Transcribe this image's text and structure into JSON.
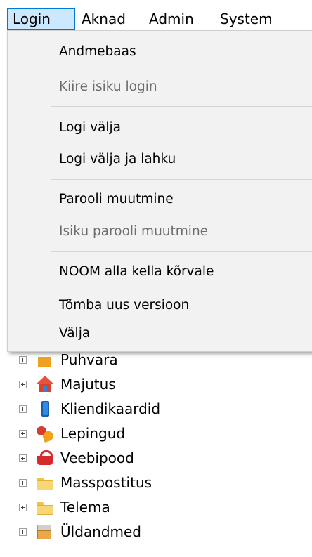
{
  "menubar": {
    "items": [
      "Login",
      "Aknad",
      "Admin",
      "System"
    ]
  },
  "login_menu": {
    "items": [
      {
        "label": "Andmebaas"
      },
      {
        "label": "Kiire isiku login"
      },
      {
        "label": "Logi välja"
      },
      {
        "label": "Logi välja ja lahku"
      },
      {
        "label": "Parooli muutmine"
      },
      {
        "label": "Isiku parooli muutmine"
      },
      {
        "label": "NOOM alla kella kõrvale"
      },
      {
        "label": "Tõmba uus versioon"
      },
      {
        "label": "Välja"
      }
    ],
    "disabled_items": [
      "Kiire isiku login",
      "Isiku parooli muutmine"
    ]
  },
  "tree": {
    "items": [
      {
        "label": "Puhvara",
        "icon": "cash-register-icon"
      },
      {
        "label": "Majutus",
        "icon": "house-icon"
      },
      {
        "label": "Kliendikaardid",
        "icon": "card-icon"
      },
      {
        "label": "Lepingud",
        "icon": "bean-icon"
      },
      {
        "label": "Veebipood",
        "icon": "basket-icon"
      },
      {
        "label": "Masspostitus",
        "icon": "folder-icon"
      },
      {
        "label": "Telema",
        "icon": "folder-icon"
      },
      {
        "label": "Üldandmed",
        "icon": "archive-icon"
      }
    ]
  },
  "colors": {
    "menu_active_bg": "#cce8ff",
    "menu_active_border": "#0078d7",
    "dropdown_bg": "#f2f2f2",
    "disabled_text": "#6d6d6d"
  }
}
